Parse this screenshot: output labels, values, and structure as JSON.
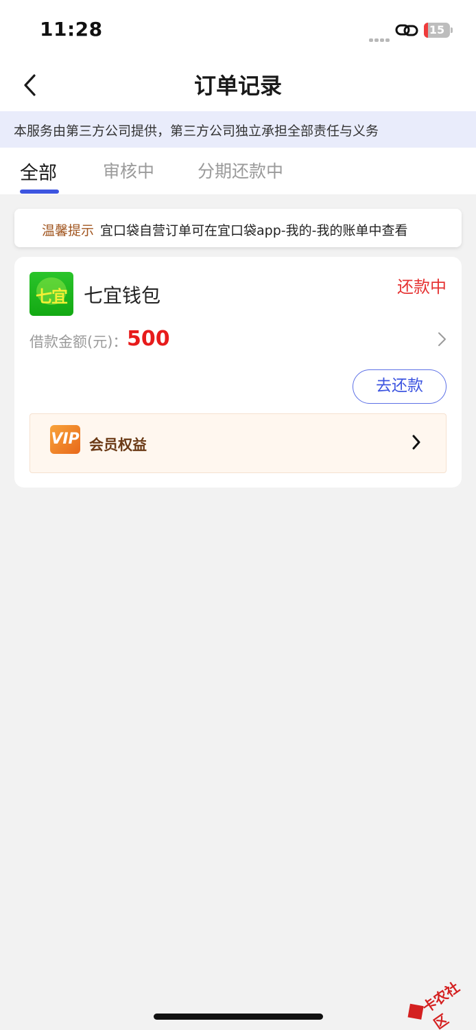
{
  "status_bar": {
    "time": "11:28",
    "battery_level": "15",
    "battery_percent": 0.15
  },
  "header": {
    "title": "订单记录",
    "back_icon": "chevron-left-icon"
  },
  "notice": {
    "text": "本服务由第三方公司提供，第三方公司独立承担全部责任与义务"
  },
  "tabs": [
    {
      "label": "全部",
      "active": true
    },
    {
      "label": "审核中",
      "active": false
    },
    {
      "label": "分期还款中",
      "active": false
    }
  ],
  "tip": {
    "label": "温馨提示",
    "text": "宜口袋自营订单可在宜口袋app-我的-我的账单中查看"
  },
  "order": {
    "logo_text": "七宜",
    "app_name": "七宜钱包",
    "status": "还款中",
    "amount_label": "借款金额(元)：",
    "amount": "500",
    "repay_button": "去还款",
    "vip_icon_text": "VIP",
    "vip_label": "会员权益"
  },
  "watermark": {
    "text": "卡农社区"
  },
  "colors": {
    "accent": "#3d55e0",
    "status_red": "#e53232",
    "amount_red": "#e71b1b",
    "notice_bg": "#e9ecfb",
    "vip_bg": "#fff7ef",
    "tip_label": "#a0541e"
  }
}
